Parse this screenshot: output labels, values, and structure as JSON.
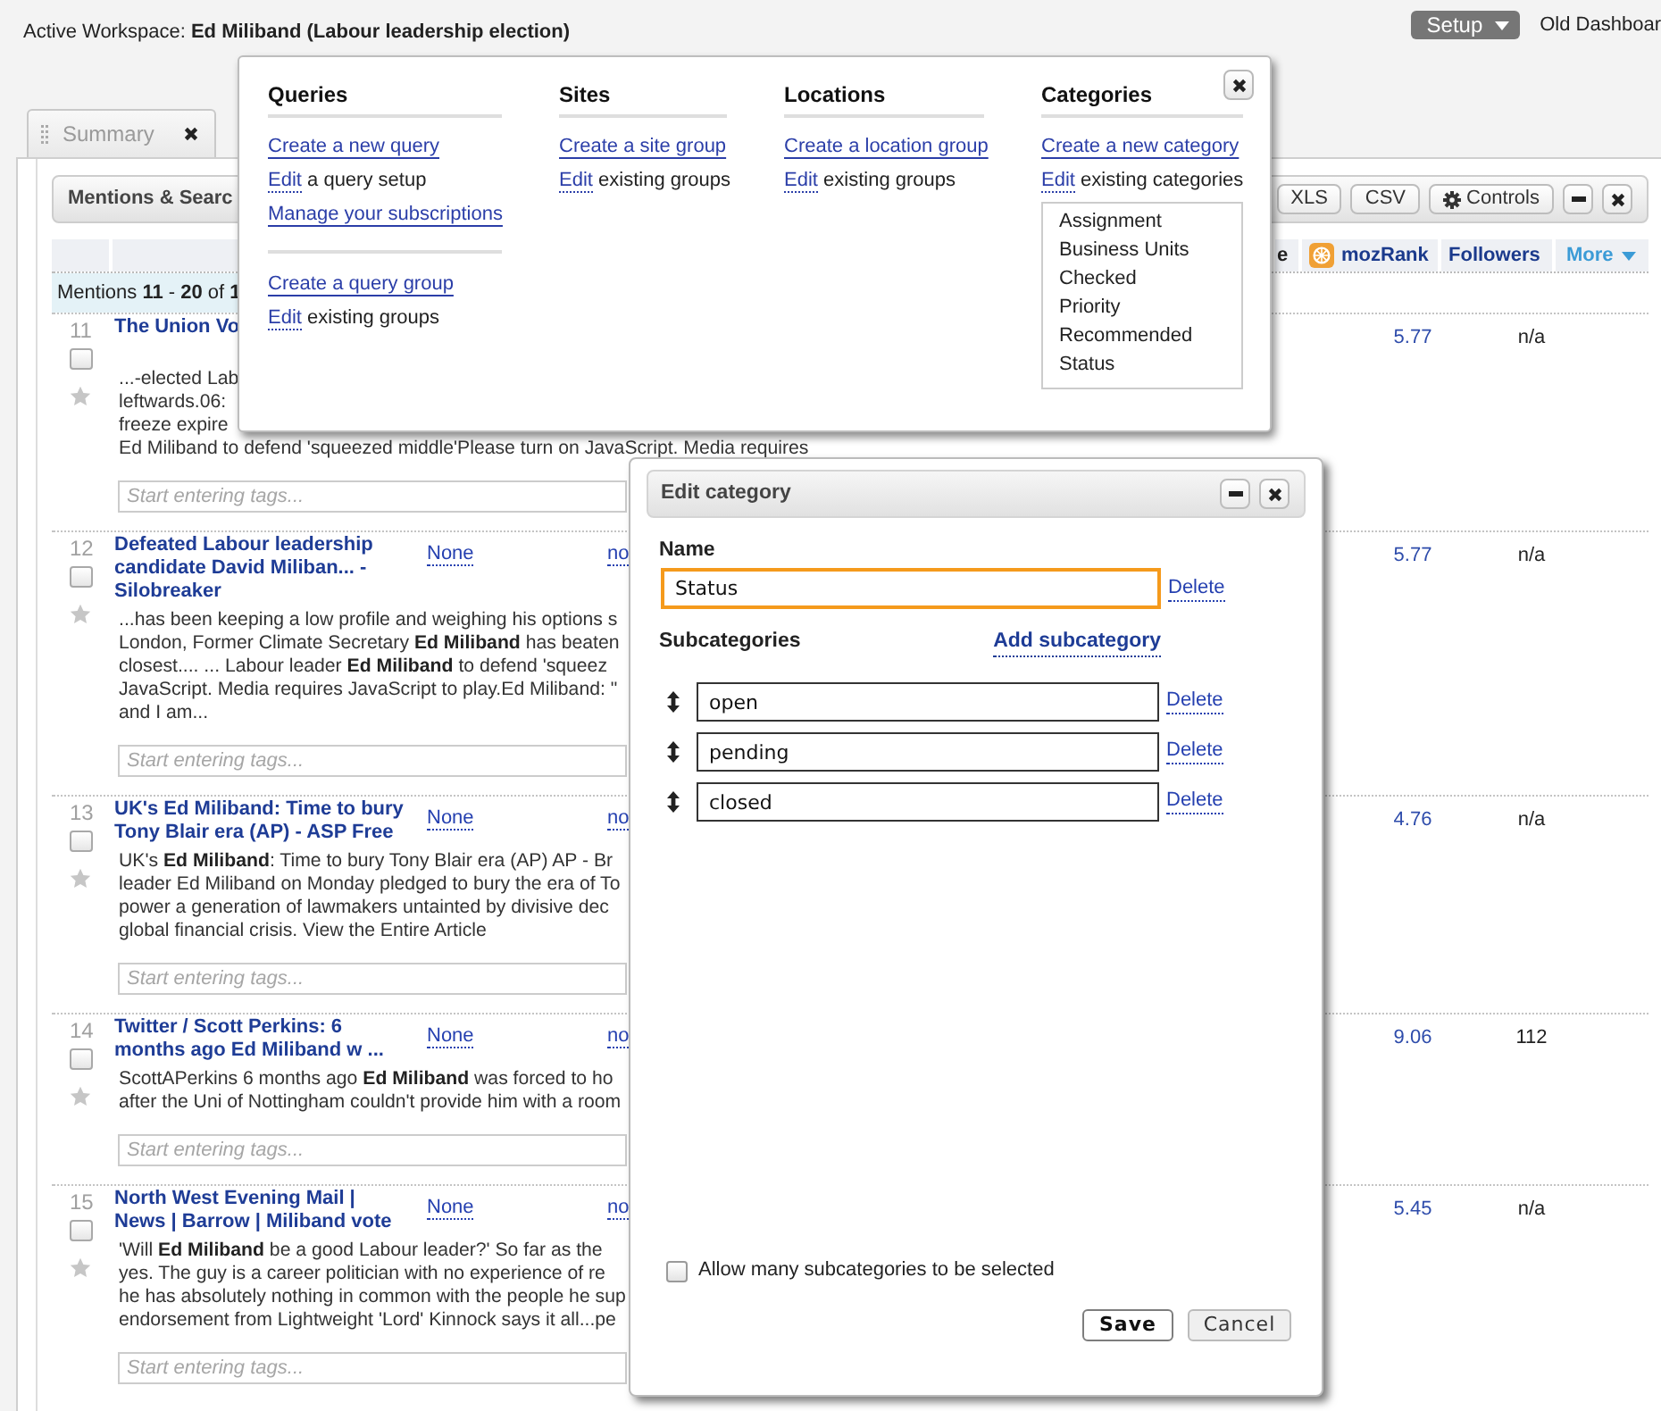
{
  "header": {
    "workspace": "Active Workspace: **Ed Miliband (Labour leadership election)**",
    "setup_button": "Setup",
    "old_dashboard": "Old Dashboar"
  },
  "tabs": [
    {
      "label": "Summary",
      "selected": false,
      "closable": true
    }
  ],
  "widget": {
    "title": "Mentions & Searc",
    "buttons": [
      {
        "label": "XLS",
        "kind": "text"
      },
      {
        "label": "CSV",
        "kind": "text"
      },
      {
        "label": "Controls",
        "kind": "gear"
      }
    ],
    "window_buttons": [
      {
        "kind": "minimize"
      },
      {
        "kind": "close"
      }
    ]
  },
  "table": {
    "columns": [
      {
        "label": "e",
        "kind": "plain"
      },
      {
        "label": "mozRank",
        "kind": "icon"
      },
      {
        "label": "Followers",
        "kind": "plain"
      },
      {
        "label": "More",
        "kind": "dropdown"
      }
    ],
    "range": "Mentions **11** - **20** of **1**",
    "rows": [
      {
        "number": "11",
        "checked": false,
        "starred": false,
        "title": "The Union Vo",
        "snippet": [
          "...-elected Lab",
          "leftwards.06:",
          "freeze expire",
          "Ed Miliband to defend 'squeezed middle'Please turn on JavaScript. Media requires"
        ],
        "tags": {
          "placeholder": "Start entering tags..."
        },
        "mozrank": "5.77",
        "followers": "n/a"
      },
      {
        "number": "12",
        "checked": false,
        "starred": false,
        "title": "Defeated Labour leadership candidate David Miliban... - Silobreaker",
        "column_3": "None",
        "column_4": "no",
        "snippet": [
          "...has been keeping a low profile and weighing his options s",
          "London, Former Climate Secretary **Ed Miliband** has beaten",
          "closest.... ... Labour leader **Ed Miliband** to defend 'squeez",
          "JavaScript. Media requires JavaScript to play.Ed Miliband: \"",
          "and I am..."
        ],
        "tags": {
          "placeholder": "Start entering tags..."
        },
        "mozrank": "5.77",
        "followers": "n/a"
      },
      {
        "number": "13",
        "checked": false,
        "starred": false,
        "title": "UK's Ed Miliband: Time to bury Tony Blair era (AP) - ASP Free",
        "column_3": "None",
        "column_4": "no",
        "snippet": [
          "UK's **Ed Miliband**: Time to bury Tony Blair era (AP) AP - Br",
          "leader Ed Miliband on Monday pledged to bury the era of To",
          "power a generation of lawmakers untainted by divisive dec",
          "global financial crisis. View the Entire Article"
        ],
        "tags": {
          "placeholder": "Start entering tags..."
        },
        "mozrank": "4.76",
        "followers": "n/a"
      },
      {
        "number": "14",
        "checked": false,
        "starred": false,
        "title": "Twitter / Scott Perkins: 6 months ago Ed Miliband w ...",
        "column_3": "None",
        "column_4": "no",
        "snippet": [
          "ScottAPerkins 6 months ago **Ed Miliband** was forced to ho",
          "after the Uni of Nottingham couldn't provide him with a room"
        ],
        "tags": {
          "placeholder": "Start entering tags..."
        },
        "mozrank": "9.06",
        "followers": "112"
      },
      {
        "number": "15",
        "checked": false,
        "starred": false,
        "title": "North West Evening Mail | News | Barrow | Miliband vote",
        "column_3": "None",
        "column_4": "no",
        "snippet": [
          "'Will **Ed Miliband** be a good Labour leader?' So far as the",
          "yes. The guy is a career politician with no experience of re",
          "he has absolutely nothing in common with the people he sup",
          "endorsement from Lightweight 'Lord' Kinnock says it all...pe"
        ],
        "tags": {
          "placeholder": "Start entering tags..."
        },
        "mozrank": "5.45",
        "followers": "n/a"
      }
    ]
  },
  "setup_menu": {
    "columns": [
      {
        "heading": "Queries",
        "items": [
          {
            "kind": "link",
            "text": "Create a new query"
          },
          {
            "kind": "edit",
            "link": "Edit",
            "text": "a query setup"
          },
          {
            "kind": "link",
            "text": "Manage your subscriptions"
          },
          {
            "kind": "divider"
          },
          {
            "kind": "link",
            "text": "Create a query group"
          },
          {
            "kind": "edit",
            "link": "Edit",
            "text": "existing groups"
          }
        ]
      },
      {
        "heading": "Sites",
        "items": [
          {
            "kind": "link",
            "text": "Create a site group"
          },
          {
            "kind": "edit",
            "link": "Edit",
            "text": "existing groups"
          }
        ]
      },
      {
        "heading": "Locations",
        "items": [
          {
            "kind": "link",
            "text": "Create a location group"
          },
          {
            "kind": "edit",
            "link": "Edit",
            "text": "existing groups"
          }
        ]
      },
      {
        "heading": "Categories",
        "items": [
          {
            "kind": "link",
            "text": "Create a new category"
          },
          {
            "kind": "edit",
            "link": "Edit",
            "text": "existing categories"
          },
          {
            "kind": "list",
            "items": [
              "Assignment",
              "Business Units",
              "Checked",
              "Priority",
              "Recommended",
              "Status"
            ]
          }
        ]
      }
    ]
  },
  "edit_category": {
    "title": "Edit category",
    "window_buttons": [
      {
        "kind": "minimize"
      },
      {
        "kind": "close"
      }
    ],
    "name_label": "Name",
    "name": {
      "value": "Status",
      "focused": true
    },
    "delete": "Delete",
    "subcategories_label": "Subcategories",
    "add_link": "Add subcategory",
    "subcategories": [
      {
        "value": "open",
        "delete": "Delete"
      },
      {
        "value": "pending",
        "delete": "Delete"
      },
      {
        "value": "closed",
        "delete": "Delete"
      }
    ],
    "allow_many": {
      "label": "Allow many subcategories to be selected",
      "checked": false
    },
    "buttons": [
      {
        "label": "Save",
        "kind": "primary"
      },
      {
        "label": "Cancel",
        "kind": "secondary"
      }
    ]
  }
}
